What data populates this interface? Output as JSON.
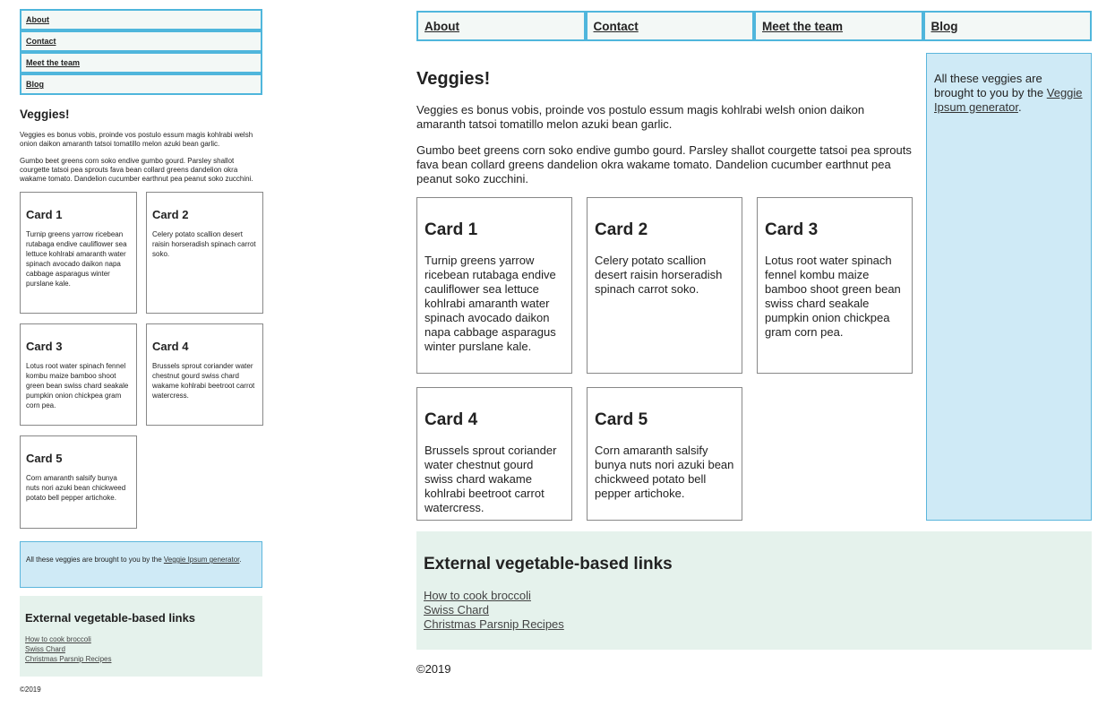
{
  "nav": [
    "About",
    "Contact",
    "Meet the team",
    "Blog"
  ],
  "title": "Veggies!",
  "intro": [
    "Veggies es bonus vobis, proinde vos postulo essum magis kohlrabi welsh onion daikon amaranth tatsoi tomatillo melon azuki bean garlic.",
    "Gumbo beet greens corn soko endive gumbo gourd. Parsley shallot courgette tatsoi pea sprouts fava bean collard greens dandelion okra wakame tomato. Dandelion cucumber earthnut pea peanut soko zucchini."
  ],
  "cards": [
    {
      "title": "Card 1",
      "text": "Turnip greens yarrow ricebean rutabaga endive cauliflower sea lettuce kohlrabi amaranth water spinach avocado daikon napa cabbage asparagus winter purslane kale."
    },
    {
      "title": "Card 2",
      "text": "Celery potato scallion desert raisin horseradish spinach carrot soko."
    },
    {
      "title": "Card 3",
      "text": "Lotus root water spinach fennel kombu maize bamboo shoot green bean swiss chard seakale pumpkin onion chickpea gram corn pea."
    },
    {
      "title": "Card 4",
      "text": "Brussels sprout coriander water chestnut gourd swiss chard wakame kohlrabi beetroot carrot watercress."
    },
    {
      "title": "Card 5",
      "text": "Corn amaranth salsify bunya nuts nori azuki bean chickweed potato bell pepper artichoke."
    }
  ],
  "aside": {
    "text_before": "All these veggies are brought to you by the ",
    "link": "Veggie Ipsum generator",
    "text_after": "."
  },
  "external": {
    "heading": "External vegetable-based links",
    "links": [
      "How to cook broccoli",
      "Swiss Chard",
      "Christmas Parsnip Recipes"
    ]
  },
  "footer": "©2019",
  "colors": {
    "nav_border": "#4fb6dc",
    "aside_bg": "#cfeaf6",
    "external_bg": "#e5f2ec"
  }
}
